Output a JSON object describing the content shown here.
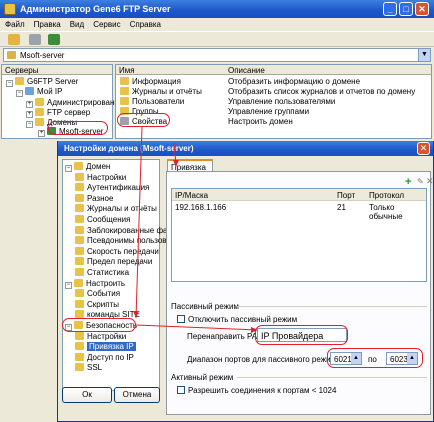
{
  "window": {
    "title": "Администратор Gene6 FTP Server"
  },
  "menu": [
    "Файл",
    "Правка",
    "Вид",
    "Сервис",
    "Справка"
  ],
  "address": {
    "value": "Msoft-server"
  },
  "tree": {
    "header": "Серверы",
    "items": [
      {
        "label": "G6FTP Server"
      },
      {
        "label": "Мой IP"
      },
      {
        "label": "Администрирование"
      },
      {
        "label": "FTP сервер"
      },
      {
        "label": "Домены"
      },
      {
        "label": "Msoft-server"
      }
    ]
  },
  "list": {
    "col_name": "Имя",
    "col_desc": "Описание",
    "rows": [
      {
        "name": "Информация",
        "desc": "Отобразить информацию о домене"
      },
      {
        "name": "Журналы и отчёты",
        "desc": "Отобразить список журналов и отчетов по домену"
      },
      {
        "name": "Пользователи",
        "desc": "Управление пользователями"
      },
      {
        "name": "Группы",
        "desc": "Управление группами"
      },
      {
        "name": "Свойства",
        "desc": "Настроить домен"
      }
    ]
  },
  "dialog": {
    "title": "Настройки домена (Msoft-server)",
    "tree": [
      "Домен",
      "Настройки",
      "Аутентификация",
      "Разное",
      "Журналы и отчёты",
      "Сообщения",
      "Заблокированные файлы",
      "Псевдонимы пользовате",
      "Скорость передачи",
      "Предел передачи",
      "Статистика",
      "Настроить",
      "События",
      "Скрипты",
      "команды SITE",
      "Безопасность",
      "Настройки",
      "Привязка IP",
      "Доступ по IP",
      "SSL"
    ],
    "ok_label": "Ок",
    "cancel_label": "Отмена",
    "tab_label": "Привязка IP",
    "table": {
      "headers": [
        "IP/Маска",
        "Порт",
        "Протокол"
      ],
      "rows": [
        {
          "ip": "192.168.1.166",
          "port": "21",
          "proto": "Только обычные"
        }
      ]
    },
    "passive": {
      "group_label": "Пассивный режим",
      "disable_label": "Отключить пассивный режим",
      "redirect_label": "Перенаправить PASV IP",
      "redirect_value": "IP Провайдера",
      "range_label": "Диапазон портов для пассивного режима",
      "port_from": "6021",
      "port_to_label": "по",
      "port_to": "6023"
    },
    "active": {
      "group_label": "Активный режим",
      "allow_label": "Разрешить соединения к портам < 1024"
    }
  }
}
